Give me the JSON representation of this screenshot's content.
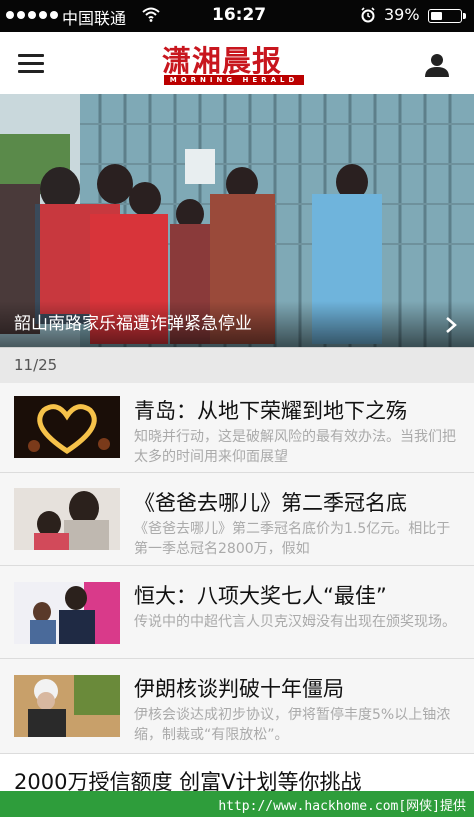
{
  "status_bar": {
    "carrier": "中国联通",
    "time": "16:27",
    "battery_percent": "39%",
    "battery_level": 0.39
  },
  "header": {
    "logo_text": "潇湘晨报",
    "logo_subtitle": "MORNING HERALD"
  },
  "hero": {
    "caption": "韶山南路家乐福遭诈弹紧急停业"
  },
  "date_label": "11/25",
  "news": [
    {
      "title": "青岛：从地下荣耀到地下之殇",
      "summary": "知晓并行动，这是破解风险的最有效办法。当我们把太多的时间用来仰面展望"
    },
    {
      "title": "《爸爸去哪儿》第二季冠名底",
      "summary": "《爸爸去哪儿》第二季冠名底价为1.5亿元。相比于第一季总冠名2800万，假如"
    },
    {
      "title": "恒大：八项大奖七人“最佳”",
      "summary": "传说中的中超代言人贝克汉姆没有出现在颁奖现场。"
    },
    {
      "title": "伊朗核谈判破十年僵局",
      "summary": "伊核会谈达成初步协议，伊将暂停丰度5%以上铀浓缩，制裁或“有限放松”。"
    }
  ],
  "banner": {
    "text": "2000万授信额度 创富V计划等你挑战"
  },
  "footer": {
    "watermark": "http://www.hackhome.com[网侠]提供"
  },
  "colors": {
    "brand_red": "#c8161e",
    "footer_green": "#2e9d3b"
  }
}
